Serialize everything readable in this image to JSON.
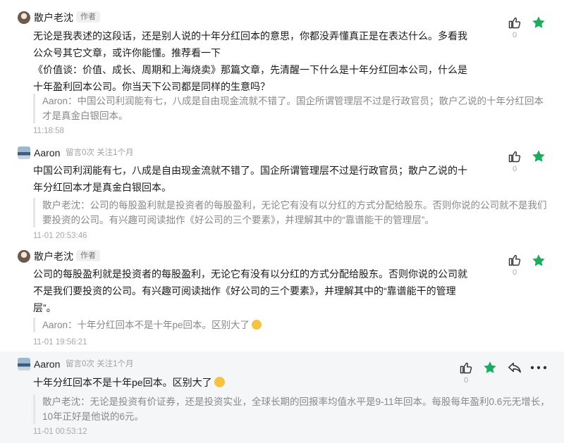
{
  "comments": [
    {
      "name": "散户老沈",
      "tag": "作者",
      "lines": [
        "无论是我表述的这段话，还是别人说的十年分红回本的意思，你都没弄懂真正是在表达什么。多看我",
        "公众号其它文章，或许你能懂。推荐看一下",
        "《价值谈：价值、成长、周期和上海烧卖》那篇文章，先清醒一下什么是十年分红回本公司，什么是",
        "十年盈利回本公司。你当天下公司都是同样的生意吗？"
      ],
      "quote_lines": [
        "Aaron：中国公司利润能有七，八成是自由现金流就不错了。国企所谓管理层不过是行政官员；散户乙说的十年分红回本",
        "才是真金白银回本。"
      ],
      "time": "11:18:58",
      "likes": "0"
    },
    {
      "name": "Aaron",
      "meta": "留言0次 关注1个月",
      "lines": [
        "中国公司利润能有七，八成是自由现金流就不错了。国企所谓管理层不过是行政官员；散户乙说的十",
        "年分红回本才是真金白银回本。"
      ],
      "quote_lines": [
        "散户老沈：公司的每股盈利就是投资者的每股盈利，无论它有没有以分红的方式分配给股东。否则你说的公司就不是我们",
        "要投资的公司。有兴趣可阅读拙作《好公司的三个要素》，并理解其中的“靠谱能干的管理层”。"
      ],
      "time": "11-01 20:53:46",
      "likes": "0"
    },
    {
      "name": "散户老沈",
      "tag": "作者",
      "lines": [
        "公司的每股盈利就是投资者的每股盈利，无论它有没有以分红的方式分配给股东。否则你说的公司就",
        "不是我们要投资的公司。有兴趣可阅读拙作《好公司的三个要素》，并理解其中的“靠谱能干的管理",
        "层”。"
      ],
      "quote_lines": [
        "Aaron：十年分红回本不是十年pe回本。区别大了"
      ],
      "time": "11-01 19:56:21",
      "likes": "0"
    },
    {
      "name": "Aaron",
      "meta": "留言0次 关注1个月",
      "lines": [
        "十年分红回本不是十年pe回本。区别大了"
      ],
      "quote_lines": [
        "散户老沈：无论是投资有价证券，还是投资实业，全球长期的回报率均值水平是9-11年回本。每股每年盈利0.6元无增长，",
        "10年正好是他说的6元。"
      ],
      "time": "11-01 00:53:12",
      "likes": "0"
    }
  ],
  "colors": {
    "star": "#1aad5f",
    "highlight_bg": "#f5f6f8"
  },
  "icons": [
    "thumb-up-icon",
    "star-icon",
    "reply-icon",
    "more-icon",
    "thinking-emoji"
  ]
}
